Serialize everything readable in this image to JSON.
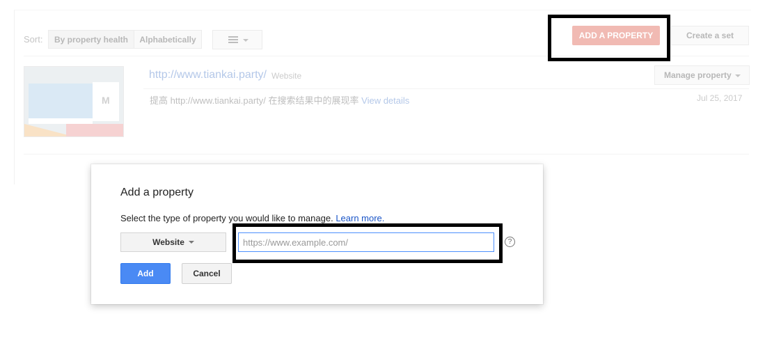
{
  "dashboard": {
    "sort_label": "Sort:",
    "sort_options": [
      "By property health",
      "Alphabetically"
    ],
    "add_property_label": "ADD A PROPERTY",
    "create_set_label": "Create a set",
    "property": {
      "url": "http://www.tiankai.party/",
      "type": "Website",
      "manage_label": "Manage property",
      "message": "提高 http://www.tiankai.party/ 在搜索结果中的展现率",
      "view_details": "View details",
      "date": "Jul 25, 2017"
    },
    "thumbnail_letter": "M"
  },
  "dialog": {
    "title": "Add a property",
    "description": "Select the type of property you would like to manage.",
    "learn_more": "Learn more.",
    "type_select": "Website",
    "url_placeholder": "https://www.example.com/",
    "help_glyph": "?",
    "add_label": "Add",
    "cancel_label": "Cancel"
  },
  "colors": {
    "add_property_red": "#dd4b39",
    "primary_blue": "#4a8af4",
    "link_blue": "#1a55c7",
    "highlight": "#000000"
  }
}
